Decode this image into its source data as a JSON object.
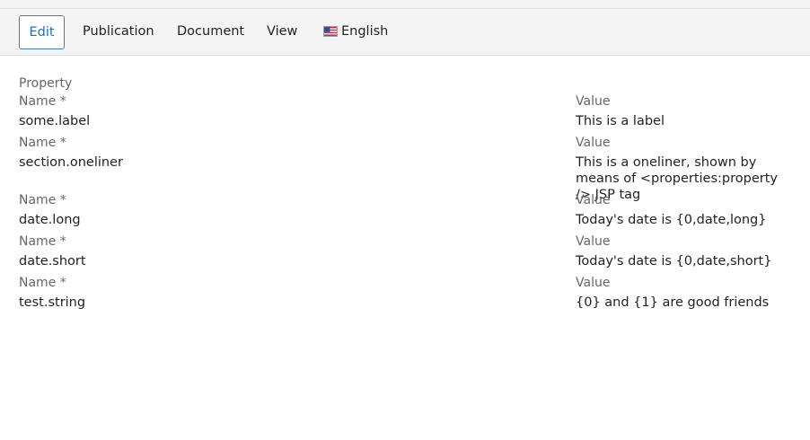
{
  "toolbar": {
    "tabs": {
      "edit": "Edit",
      "publication": "Publication",
      "document": "Document",
      "view": "View",
      "language": "English"
    },
    "language_icon": "us-flag-icon"
  },
  "properties": {
    "heading": "Property",
    "name_label": "Name *",
    "value_label": "Value",
    "rows": [
      {
        "name": "some.label",
        "value": "This is a label"
      },
      {
        "name": "section.oneliner",
        "value": "This is a oneliner, shown by means of <properties:property /> JSP tag"
      },
      {
        "name": "date.long",
        "value": "Today's date is {0,date,long}"
      },
      {
        "name": "date.short",
        "value": "Today's date is {0,date,short}"
      },
      {
        "name": "test.string",
        "value": "{0} and {1} are good friends"
      }
    ]
  },
  "colors": {
    "accent": "#1f6fbf",
    "toolbar_bg": "#f4f4f4",
    "label_gray": "#666666"
  }
}
